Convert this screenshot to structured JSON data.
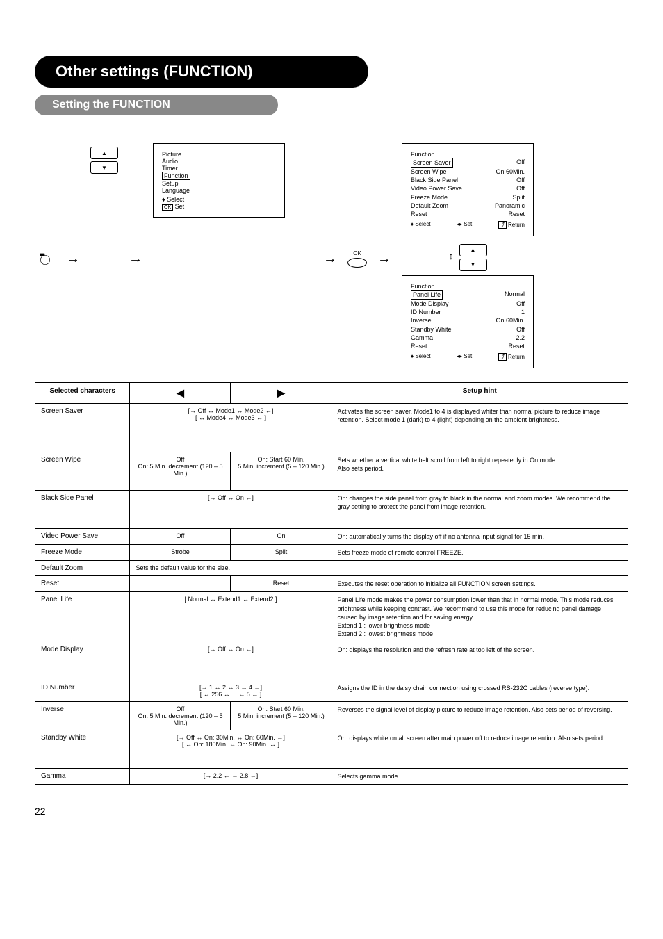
{
  "header": "Other settings (FUNCTION)",
  "subheader": "Setting the FUNCTION",
  "mainMenu": {
    "items": [
      "Picture",
      "Audio",
      "Timer",
      "Function",
      "Setup",
      "Language"
    ],
    "selected": "Function",
    "footerSelect": "Select",
    "footerSet": "Set",
    "footerOk": "OK"
  },
  "okLabel": "OK",
  "osd1": {
    "title": "Function",
    "items": [
      {
        "label": "Screen Saver",
        "value": "Off",
        "selected": true
      },
      {
        "label": "Screen Wipe",
        "value": "On  60Min."
      },
      {
        "label": "Black Side Panel",
        "value": "Off"
      },
      {
        "label": "Video Power Save",
        "value": "Off"
      },
      {
        "label": "Freeze Mode",
        "value": "Split"
      },
      {
        "label": "Default Zoom",
        "value": "Panoramic"
      },
      {
        "label": "Reset",
        "value": "Reset"
      }
    ],
    "footer": {
      "select": "Select",
      "set": "Set",
      "return": "Return"
    }
  },
  "osd2": {
    "title": "Function",
    "items": [
      {
        "label": "Panel Life",
        "value": "Normal",
        "selected": true
      },
      {
        "label": "Mode Display",
        "value": "Off"
      },
      {
        "label": "ID Number",
        "value": "1"
      },
      {
        "label": "Inverse",
        "value": "On  60Min."
      },
      {
        "label": "Standby White",
        "value": "Off"
      },
      {
        "label": "Gamma",
        "value": "2.2"
      },
      {
        "label": "Reset",
        "value": "Reset"
      }
    ],
    "footer": {
      "select": "Select",
      "set": "Set",
      "return": "Return"
    }
  },
  "tableHeader": {
    "selected": "Selected characters",
    "hint": "Setup hint"
  },
  "rows": [
    {
      "title": "Screen Saver",
      "optionsText": "[→ Off ↔ Mode1 ↔ Mode2 ←]\n[   ↔ Mode4 ↔ Mode3 ↔  ]",
      "hint": "Activates the screen saver. Mode1 to 4 is displayed whiter than normal picture to reduce image retention. Select mode 1 (dark) to 4 (light) depending on the ambient brightness."
    },
    {
      "title": "Screen Wipe",
      "leftText": "Off\nOn: 5 Min. decrement (120 – 5 Min.)",
      "rightText": "On: Start 60 Min.\n5 Min. increment (5 – 120 Min.)",
      "hint": "Sets whether a vertical white belt scroll from left to right repeatedly in On mode.\nAlso sets period."
    },
    {
      "title": "Black Side Panel",
      "optionsText": "[→ Off ↔ On ←]",
      "hint": "On: changes the side panel from gray to black in the normal and zoom modes. We recommend the gray setting to protect the panel from image retention."
    },
    {
      "title": "Video Power Save",
      "leftText": "Off",
      "rightText": "On",
      "hint": "On: automatically turns the display off if no antenna input signal for 15 min."
    },
    {
      "title": "Freeze Mode",
      "leftText": "Strobe",
      "rightText": "Split",
      "hint": "Sets freeze mode of remote control FREEZE."
    },
    {
      "title": "Default Zoom",
      "span": true,
      "optionsText": "Sets the default value for the size.",
      "hint": ""
    },
    {
      "title": "Reset",
      "leftText": "",
      "rightText": "Reset",
      "hint": "Executes the reset operation to initialize all FUNCTION screen settings."
    },
    {
      "title": "Panel Life",
      "optionsText": "[ Normal ↔ Extend1 ↔ Extend2 ]",
      "hint": "Panel Life mode makes the power consumption lower than that in normal mode. This mode reduces brightness while keeping contrast. We recommend to use this mode for reducing panel damage caused by image retention and for saving energy.\nExtend 1 : lower brightness mode\nExtend 2 : lowest brightness mode"
    },
    {
      "title": "Mode Display",
      "optionsText": "[→ Off ↔ On ←]",
      "hint": "On: displays the resolution and the refresh rate at top left of the screen."
    },
    {
      "title": "ID Number",
      "optionsText": "[→ 1 ↔ 2 ↔ 3 ↔ 4 ←]\n[  ↔ 256 ↔ ... ↔ 5 ↔  ]",
      "hint": "Assigns the ID in the daisy chain connection using crossed RS-232C cables (reverse type)."
    },
    {
      "title": "Inverse",
      "leftText": "Off\nOn: 5 Min. decrement (120 – 5 Min.)",
      "rightText": "On: Start 60 Min.\n5 Min. increment (5 – 120 Min.)",
      "hint": "Reverses the signal level of display picture to reduce image retention. Also sets period of reversing."
    },
    {
      "title": "Standby White",
      "optionsText": "[→ Off ↔ On: 30Min. ↔ On: 60Min. ←]\n[   ↔ On: 180Min. ↔ On: 90Min. ↔  ]",
      "hint": "On: displays white on all screen after main power off to reduce image retention. Also sets period."
    },
    {
      "title": "Gamma",
      "optionsText": "[→ 2.2 ← → 2.8 ←]",
      "hint": "Selects gamma mode."
    }
  ],
  "pageNumber": "22"
}
